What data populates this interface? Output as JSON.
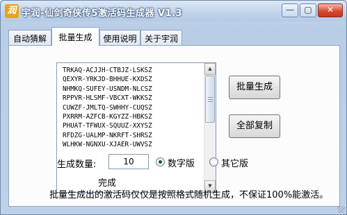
{
  "window": {
    "title": "宇润-仙剑奇侠传5激活码生成器 V1.3",
    "app_icon_glyph": "润",
    "controls": {
      "minimize": "—",
      "maximize": "▢",
      "close": "✕"
    }
  },
  "tabs": [
    {
      "label": "自动猜解",
      "active": false
    },
    {
      "label": "批量生成",
      "active": true
    },
    {
      "label": "使用说明",
      "active": false
    },
    {
      "label": "关于宇润",
      "active": false
    }
  ],
  "codes": [
    "TRKAQ-ACJJH-CTBJZ-LSKSZ",
    "QEXYR-YRKJD-BHHUE-KXDSZ",
    "NHMKQ-SUFEY-USNDM-NLCSZ",
    "RPPVR-HLSMF-VBCXT-WKKSZ",
    "CUWZF-JMLTQ-SWHHY-CUQSZ",
    "PXRRM-AZFCB-KGYZZ-HBKSZ",
    "PHUAT-TFWUX-SQUUZ-XXYSZ",
    "RFDZG-UALMP-NKRFT-SHRSZ",
    "WLHKW-NGNXU-XJAER-UWVSZ"
  ],
  "buttons": {
    "generate": "批量生成",
    "copy_all": "全部复制"
  },
  "count": {
    "label": "生成数量:",
    "value": "10"
  },
  "radios": [
    {
      "label": "数字版",
      "selected": true
    },
    {
      "label": "其它版",
      "selected": false
    }
  ],
  "status": "完成",
  "note": "批量生成出的激活码仅仅是按照格式随机生成，不保证100%能激活。"
}
